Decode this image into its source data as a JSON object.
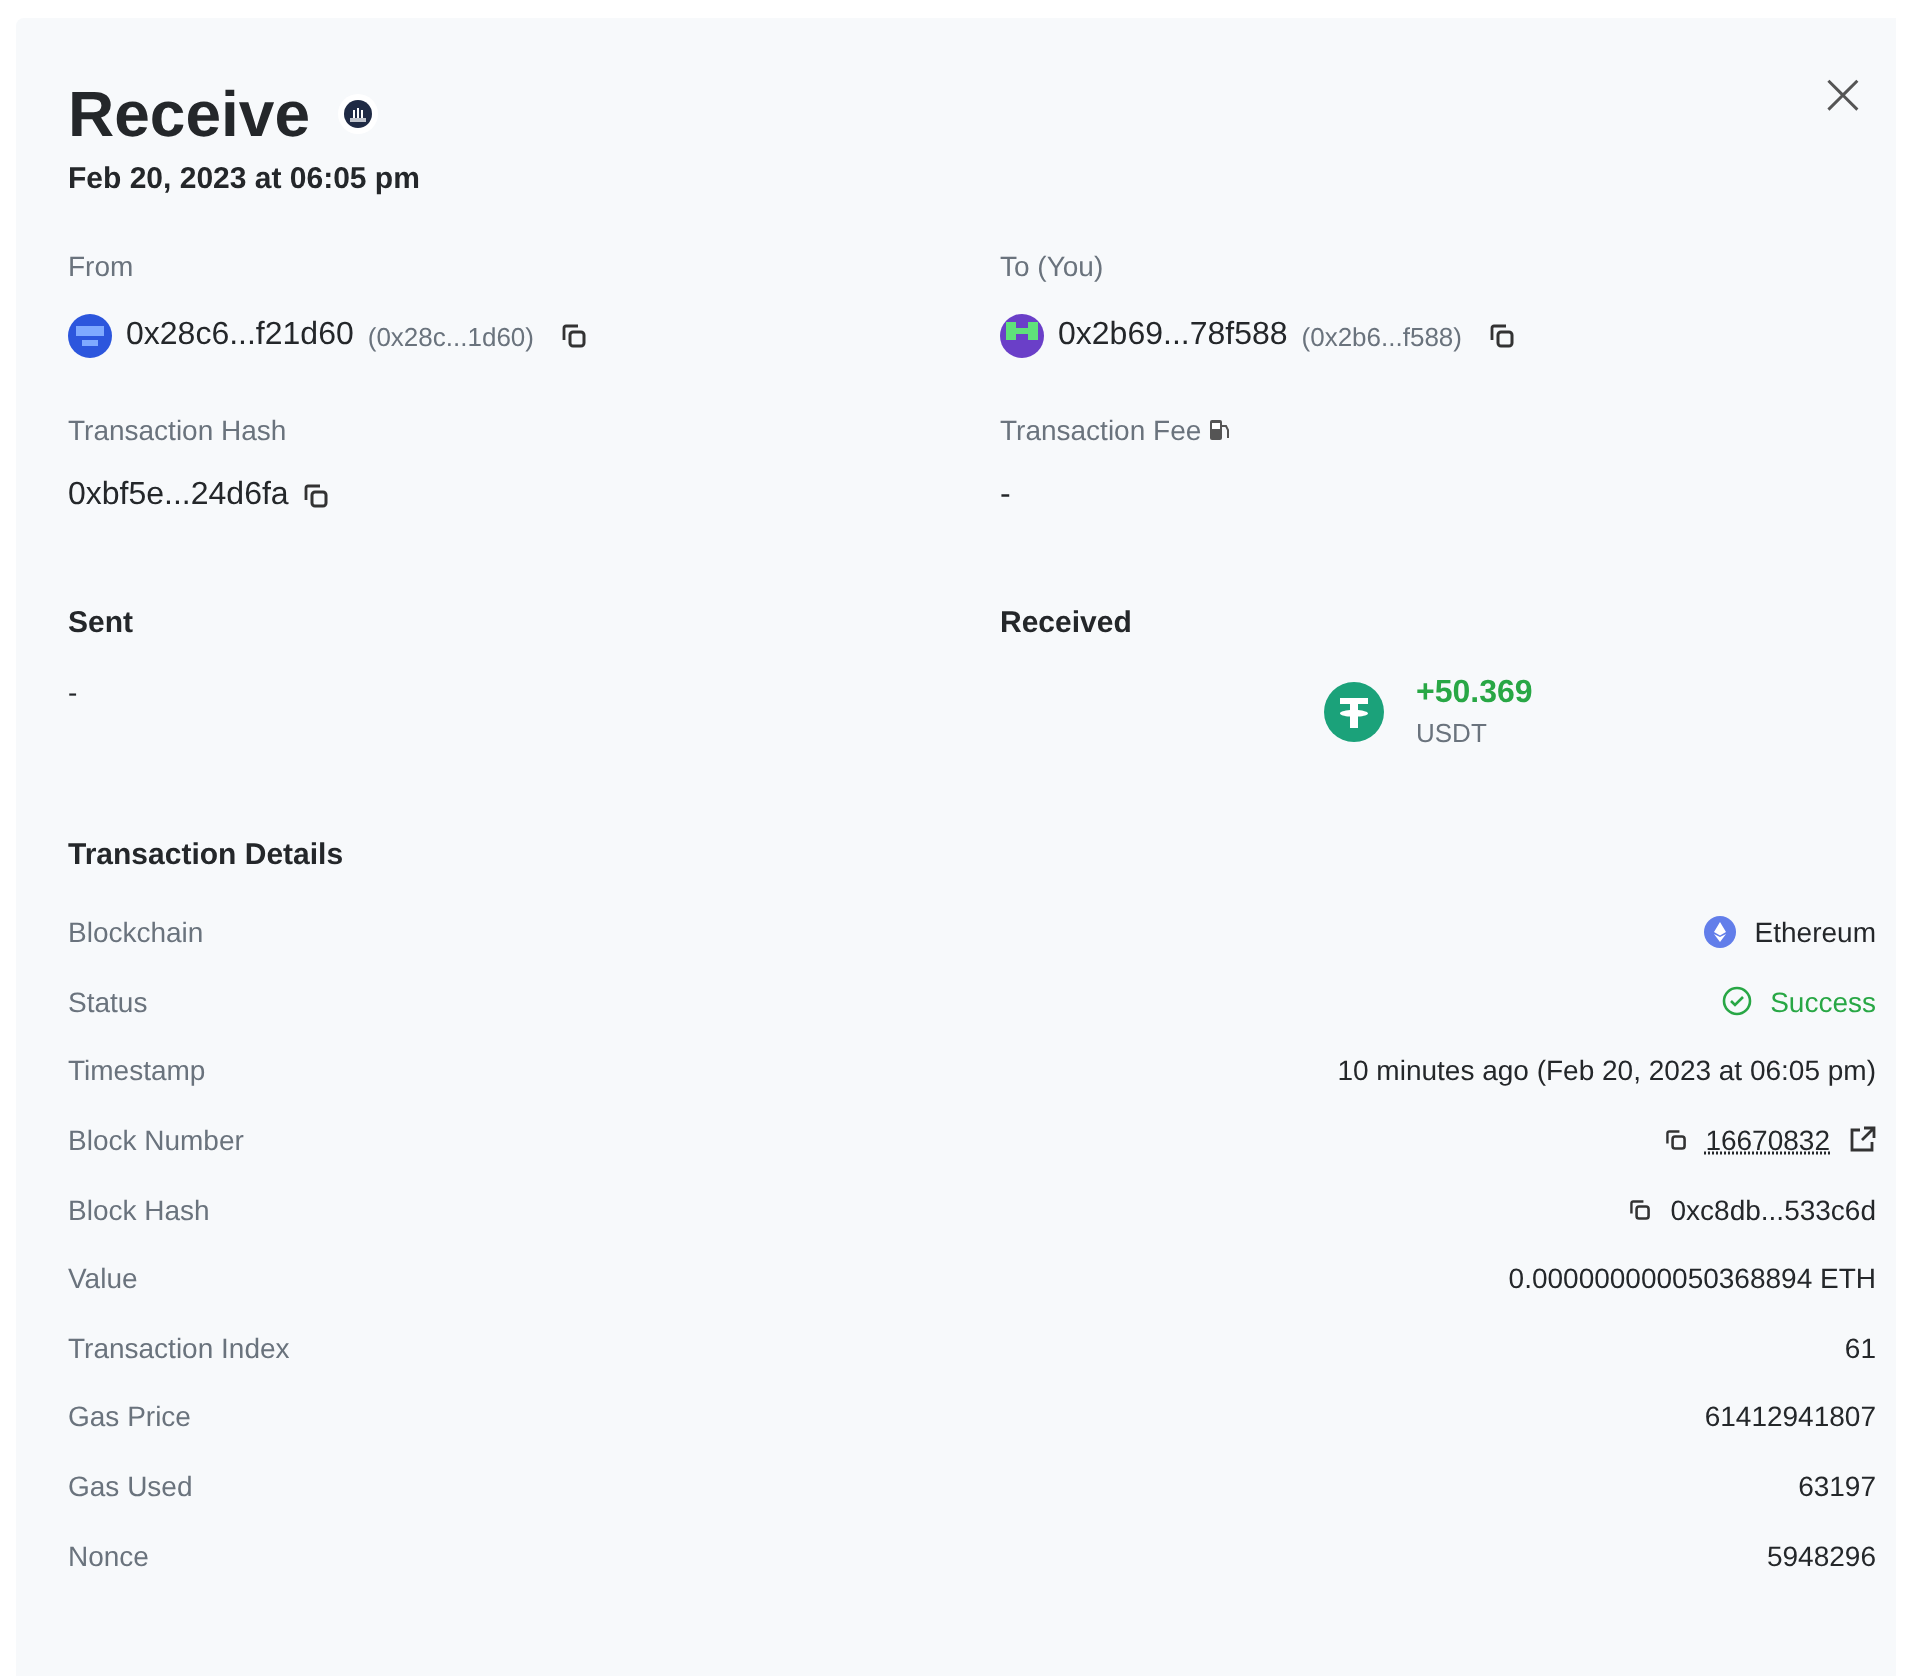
{
  "header": {
    "title": "Receive",
    "date": "Feb 20, 2023 at 06:05 pm",
    "close": "×"
  },
  "parties": [
    {
      "label": "From",
      "address": "0x28c6...f21d60",
      "alias": "(0x28c...1d60)"
    },
    {
      "label": "To (You)",
      "address": "0x2b69...78f588",
      "alias": "(0x2b6...f588)"
    }
  ],
  "hash": {
    "label": "Transaction Hash",
    "value": "0xbf5e...24d6fa"
  },
  "fee": {
    "label": "Transaction Fee",
    "value": "-"
  },
  "sent": {
    "label": "Sent",
    "value": "-"
  },
  "received": {
    "label": "Received",
    "amount": "+50.369",
    "symbol": "USDT"
  },
  "details": {
    "title": "Transaction Details",
    "rows": [
      {
        "kind": "chain",
        "label": "Blockchain",
        "value": "Ethereum"
      },
      {
        "kind": "status",
        "label": "Status",
        "value": "Success"
      },
      {
        "kind": "text",
        "label": "Timestamp",
        "value": "10 minutes ago (Feb 20, 2023 at 06:05 pm)"
      },
      {
        "kind": "block",
        "label": "Block Number",
        "value": "16670832"
      },
      {
        "kind": "hash",
        "label": "Block Hash",
        "value": "0xc8db...533c6d"
      },
      {
        "kind": "text",
        "label": "Value",
        "value": "0.000000000050368894 ETH"
      },
      {
        "kind": "text",
        "label": "Transaction Index",
        "value": "61"
      },
      {
        "kind": "text",
        "label": "Gas Price",
        "value": "61412941807"
      },
      {
        "kind": "text",
        "label": "Gas Used",
        "value": "63197"
      },
      {
        "kind": "text",
        "label": "Nonce",
        "value": "5948296"
      }
    ]
  }
}
